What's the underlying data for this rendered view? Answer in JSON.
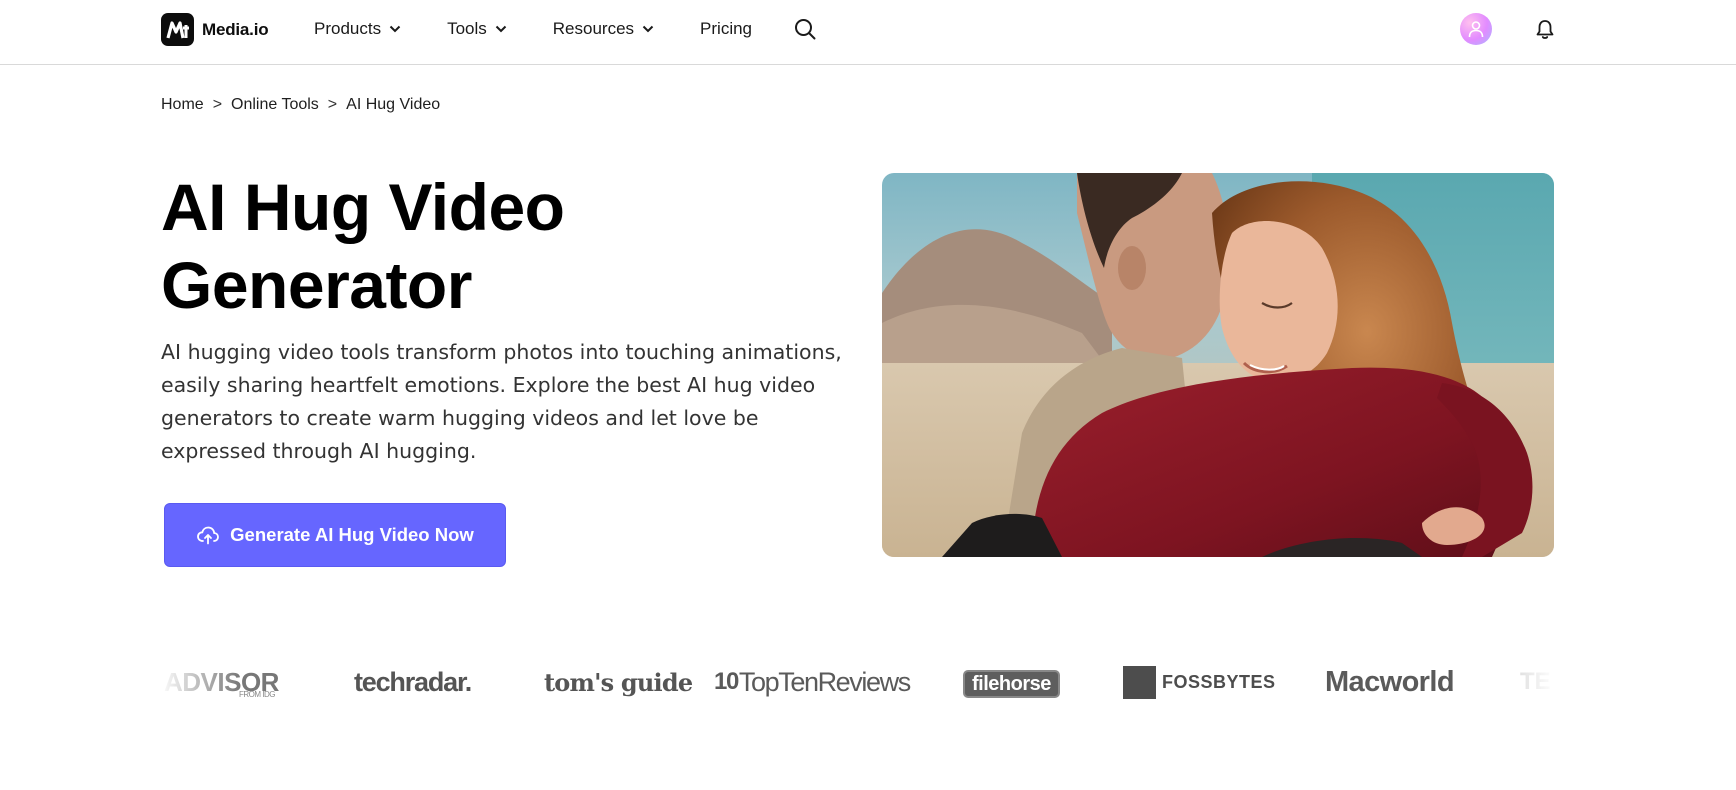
{
  "header": {
    "logo_text": "Media.io",
    "nav": [
      {
        "label": "Products",
        "has_dropdown": true
      },
      {
        "label": "Tools",
        "has_dropdown": true
      },
      {
        "label": "Resources",
        "has_dropdown": true
      },
      {
        "label": "Pricing",
        "has_dropdown": false
      }
    ],
    "search_icon": "search-icon",
    "avatar_icon": "user-avatar-icon",
    "bell_icon": "bell-icon"
  },
  "breadcrumb": {
    "items": [
      "Home",
      "Online Tools",
      "AI Hug Video"
    ],
    "separator": ">"
  },
  "hero": {
    "title_line1": "AI Hug Video",
    "title_line2": "Generator",
    "description": "AI hugging video tools transform photos into touching animations, easily sharing heartfelt emotions. Explore the best AI hug video generators to create warm hugging videos and let love be expressed through AI hugging.",
    "cta_label": "Generate AI Hug Video Now",
    "cta_icon": "cloud-upload-icon",
    "image_description": "A man and a woman embracing in a desert landscape"
  },
  "press_logos": {
    "items": [
      {
        "name": "ADVISOR",
        "sub": "FROM IDG"
      },
      {
        "name": "techradar."
      },
      {
        "name": "tom's guide"
      },
      {
        "name": "TopTenReviews",
        "prefix": "10"
      },
      {
        "name": "filehorse"
      },
      {
        "name": "FOSSBYTES"
      },
      {
        "name": "Macworld"
      },
      {
        "name": "TE"
      }
    ]
  },
  "colors": {
    "cta_background": "#6666ff",
    "text_primary": "#000000",
    "text_secondary": "#333333",
    "border": "#d9d9d9"
  }
}
